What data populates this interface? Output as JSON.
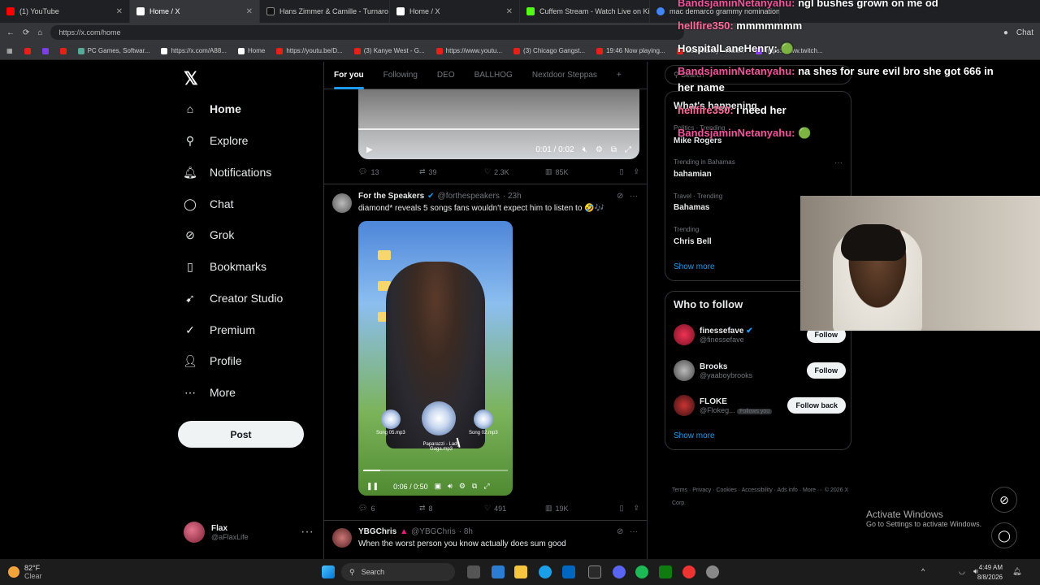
{
  "browser": {
    "tabs": [
      {
        "label": "(1) YouTube",
        "color": "#ff0000"
      },
      {
        "label": "Home / X",
        "color": "#ffffff"
      },
      {
        "label": "Hans Zimmer & Camille - Turnaro",
        "color": "#000000"
      },
      {
        "label": "Home / X",
        "color": "#ffffff"
      },
      {
        "label": "Cuffem Stream - Watch Live on Ki",
        "color": "#53fc18"
      },
      {
        "label": "mac demarco grammy nomination",
        "color": "#4285f4"
      }
    ],
    "url": "https://x.com/home",
    "chat_button": "Chat",
    "bookmarks": [
      "PC Games, Softwar...",
      "https://x.com/A88...",
      "Home",
      "https://youtu.be/D...",
      "(3) Kanye West - G...",
      "https://www.youtu...",
      "(3) Chicago Gangst...",
      "19:46 Now playing...",
      "Bob Marley - Waiti...",
      "https://www.twitch..."
    ]
  },
  "sidebar": {
    "logo": "𝕏",
    "items": [
      {
        "label": "Home"
      },
      {
        "label": "Explore"
      },
      {
        "label": "Notifications"
      },
      {
        "label": "Chat"
      },
      {
        "label": "Grok"
      },
      {
        "label": "Bookmarks"
      },
      {
        "label": "Creator Studio"
      },
      {
        "label": "Premium"
      },
      {
        "label": "Profile"
      },
      {
        "label": "More"
      }
    ],
    "post_button": "Post",
    "account": {
      "name": "Flax",
      "handle": "@aFlaxLife"
    }
  },
  "timeline": {
    "tabs": [
      "For you",
      "Following",
      "DEO",
      "BALLHOG",
      "Nextdoor Steppas"
    ],
    "post1": {
      "time": "0:01 / 0:02",
      "replies": "13",
      "reposts": "39",
      "likes": "2.3K",
      "views": "85K"
    },
    "post2": {
      "name": "For the Speakers",
      "handle": "@forthespeakers",
      "age": "· 23h",
      "text": "diamond* reveals 5 songs fans wouldn't expect him to listen to 🤣🎶",
      "disc_labels": [
        "Song 05.mp3",
        "Paparazzi - Lady Gaga.mp3",
        "Song 02.mp3"
      ],
      "time": "0:06 / 0:50",
      "replies": "6",
      "reposts": "8",
      "likes": "491",
      "views": "19K"
    },
    "post3": {
      "name": "YBGChris",
      "handle": "@YBGChris",
      "age": "· 8h",
      "text": "When the worst person you know actually does sum good"
    }
  },
  "right": {
    "search_placeholder": "Search",
    "happening_title": "What's happening",
    "trends": [
      {
        "meta": "Politics · Trending",
        "name": "Mike Rogers"
      },
      {
        "meta": "Trending in Bahamas",
        "name": "bahamian"
      },
      {
        "meta": "Travel · Trending",
        "name": "Bahamas"
      },
      {
        "meta": "Trending",
        "name": "Chris Bell"
      }
    ],
    "show_more": "Show more",
    "who_to_follow": "Who to follow",
    "follow": [
      {
        "name": "finessefave",
        "handle": "@finessefave",
        "button": "Follow"
      },
      {
        "name": "Brooks",
        "handle": "@yaaboybrooks",
        "button": "Follow"
      },
      {
        "name": "FLOKE",
        "handle": "@Flokeg...",
        "badge": "Follows you",
        "button": "Follow back"
      }
    ],
    "show_more2": "Show more",
    "footer": "Terms · Privacy · Cookies · Accessibility · Ads info · More ··· © 2026 X Corp."
  },
  "overlay_chat": [
    {
      "user": "BandsjaminNetanyahu:",
      "msg": "ngl bushes grown on me od"
    },
    {
      "user": "hellfire350:",
      "msg": "mmmmmmm"
    },
    {
      "user": "HospitalLaneHenry:",
      "msg": "🟢"
    },
    {
      "user": "BandsjaminNetanyahu:",
      "msg": "na shes for sure evil bro she got 666 in"
    },
    {
      "user": "",
      "msg": "her name"
    },
    {
      "user": "hellfire350:",
      "msg": "i need her"
    },
    {
      "user": "BandsjaminNetanyahu:",
      "msg": "🟢"
    }
  ],
  "windows": {
    "activate_title": "Activate Windows",
    "activate_sub": "Go to Settings to activate Windows.",
    "weather_temp": "82°F",
    "weather_desc": "Clear",
    "search": "Search",
    "time": "4:49 AM",
    "date": "8/8/2026"
  }
}
